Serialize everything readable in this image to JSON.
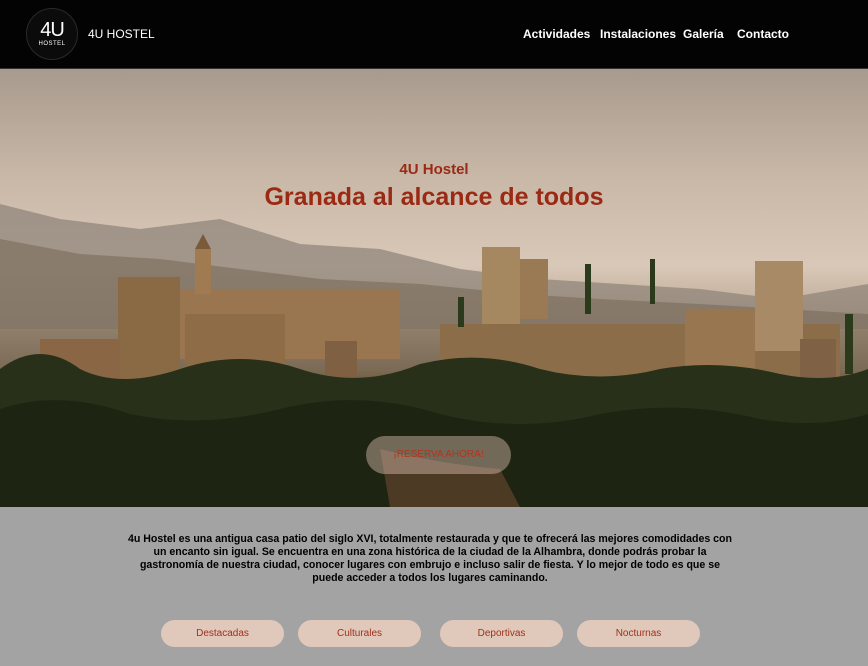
{
  "header": {
    "logo_top": "4U",
    "logo_bottom": "HOSTEL",
    "brand": "4U HOSTEL",
    "menu": [
      "Actividades",
      "Instalaciones",
      "Galería",
      "Contacto"
    ]
  },
  "hero": {
    "subtitle": "4U Hostel",
    "title": "Granada al alcance de todos",
    "cta": "¡RESERVA AHORA!"
  },
  "description": "4u Hostel es una antigua casa patio del siglo XVI, totalmente restaurada y que te ofrecerá las mejores comodidades con un encanto sin igual. Se encuentra en una zona histórica de la ciudad de la Alhambra, donde podrás probar la gastronomía de nuestra ciudad, conocer lugares con embrujo e incluso salir de fiesta. Y lo mejor de todo es que se puede acceder a todos los lugares caminando.",
  "categories": [
    "Destacadas",
    "Culturales",
    "Deportivas",
    "Nocturnas"
  ],
  "colors": {
    "accent": "#9a2a14",
    "nav_bg": "#030303",
    "pill_bg": "#e0c8bb"
  }
}
